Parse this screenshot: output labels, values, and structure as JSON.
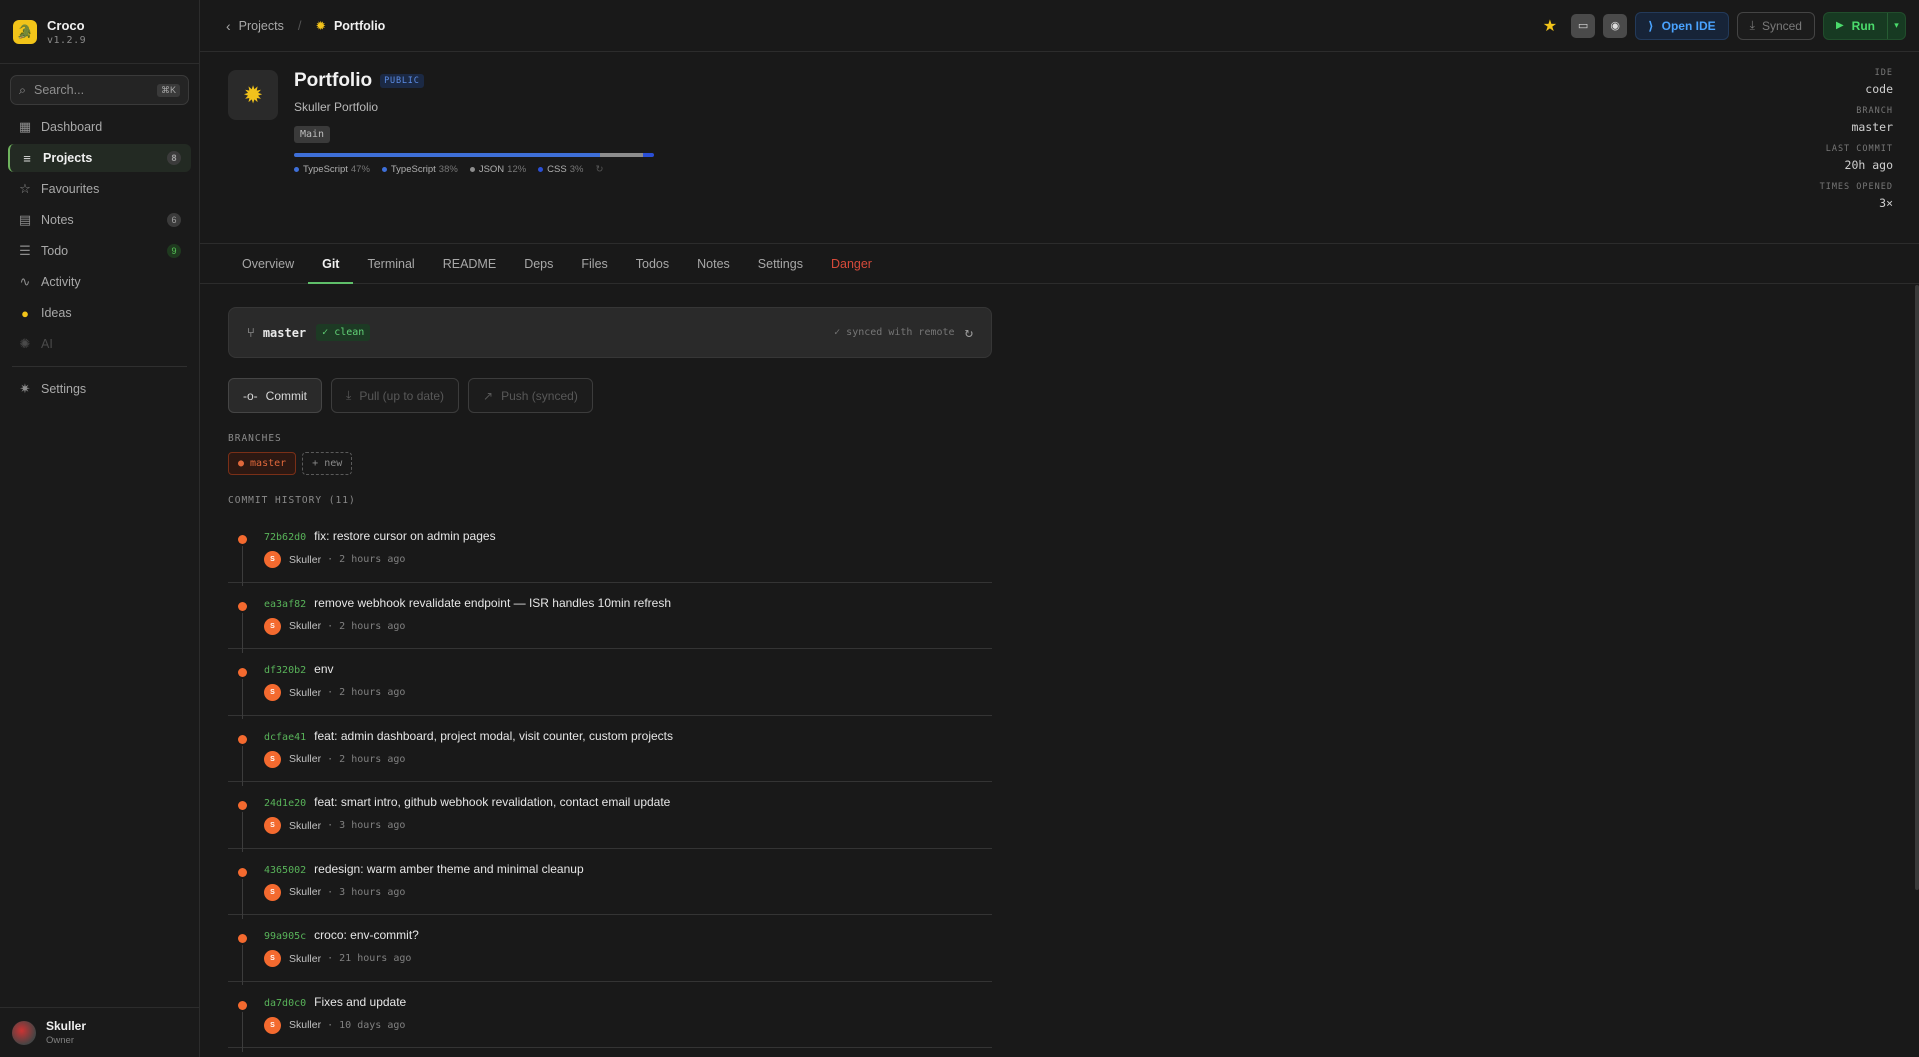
{
  "sidebar": {
    "brand": {
      "name": "Croco",
      "version": "v1.2.9"
    },
    "search": {
      "placeholder": "Search...",
      "shortcut": "⌘K"
    },
    "items": [
      {
        "label": "Dashboard",
        "icon": "grid-icon",
        "badge": ""
      },
      {
        "label": "Projects",
        "icon": "projects-icon",
        "badge": "8"
      },
      {
        "label": "Favourites",
        "icon": "star-icon",
        "badge": ""
      },
      {
        "label": "Notes",
        "icon": "note-icon",
        "badge": "6"
      },
      {
        "label": "Todo",
        "icon": "list-icon",
        "badge": "9"
      },
      {
        "label": "Activity",
        "icon": "activity-icon",
        "badge": ""
      },
      {
        "label": "Ideas",
        "icon": "bulb-icon",
        "badge": ""
      },
      {
        "label": "AI",
        "icon": "sparkle-icon",
        "badge": ""
      }
    ],
    "settings_label": "Settings",
    "user": {
      "name": "Skuller",
      "role": "Owner"
    }
  },
  "topbar": {
    "back_label": "Projects",
    "current": "Portfolio",
    "open_ide": "Open IDE",
    "synced": "Synced",
    "run": "Run"
  },
  "project": {
    "name": "Portfolio",
    "visibility": "PUBLIC",
    "description": "Skuller Portfolio",
    "tag": "Main",
    "languages": [
      {
        "name": "TypeScript",
        "pct": "47%",
        "value": 47,
        "color": "#3e6fd8"
      },
      {
        "name": "TypeScript",
        "pct": "38%",
        "value": 38,
        "color": "#3e6fd8"
      },
      {
        "name": "JSON",
        "pct": "12%",
        "value": 12,
        "color": "#8d8d8d"
      },
      {
        "name": "CSS",
        "pct": "3%",
        "value": 3,
        "color": "#2a4fd6"
      }
    ],
    "meta": {
      "ide_label": "IDE",
      "ide": "code",
      "branch_label": "BRANCH",
      "branch": "master",
      "last_commit_label": "LAST COMMIT",
      "last_commit": "20h ago",
      "opened_label": "TIMES OPENED",
      "opened": "3×"
    }
  },
  "tabs": [
    "Overview",
    "Git",
    "Terminal",
    "README",
    "Deps",
    "Files",
    "Todos",
    "Notes",
    "Settings",
    "Danger"
  ],
  "git": {
    "branch": "master",
    "status": "✓ clean",
    "synced_note": "✓ synced with remote",
    "actions": {
      "commit": "Commit",
      "pull": "Pull (up to date)",
      "push": "Push (synced)"
    },
    "branches_label": "BRANCHES",
    "current_branch_chip": "● master",
    "new_branch": "+ new",
    "history_label": "COMMIT HISTORY (11)",
    "commits": [
      {
        "hash": "72b62d0",
        "message": "fix: restore cursor on admin pages",
        "author": "Skuller",
        "initial": "S",
        "time": "· 2 hours ago"
      },
      {
        "hash": "ea3af82",
        "message": "remove webhook revalidate endpoint — ISR handles 10min refresh",
        "author": "Skuller",
        "initial": "S",
        "time": "· 2 hours ago"
      },
      {
        "hash": "df320b2",
        "message": "env",
        "author": "Skuller",
        "initial": "S",
        "time": "· 2 hours ago"
      },
      {
        "hash": "dcfae41",
        "message": "feat: admin dashboard, project modal, visit counter, custom projects",
        "author": "Skuller",
        "initial": "S",
        "time": "· 2 hours ago"
      },
      {
        "hash": "24d1e20",
        "message": "feat: smart intro, github webhook revalidation, contact email update",
        "author": "Skuller",
        "initial": "S",
        "time": "· 3 hours ago"
      },
      {
        "hash": "4365002",
        "message": "redesign: warm amber theme and minimal cleanup",
        "author": "Skuller",
        "initial": "S",
        "time": "· 3 hours ago"
      },
      {
        "hash": "99a905c",
        "message": "croco: env-commit?",
        "author": "Skuller",
        "initial": "S",
        "time": "· 21 hours ago"
      },
      {
        "hash": "da7d0c0",
        "message": "Fixes and update",
        "author": "Skuller",
        "initial": "S",
        "time": "· 10 days ago"
      }
    ]
  }
}
